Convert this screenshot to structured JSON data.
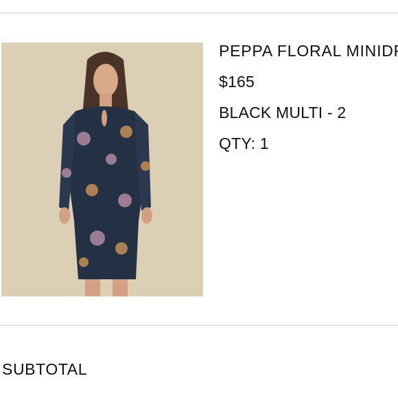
{
  "cart_item": {
    "name": "PEPPA FLORAL MINIDRESS",
    "price": "$165",
    "variant": "BLACK MULTI - 2",
    "quantity": "QTY: 1",
    "image_alt": "Model wearing a long-sleeve navy floral print minidress"
  },
  "summary": {
    "subtotal_label": "SUBTOTAL"
  },
  "colors": {
    "divider": "#e4e4e4",
    "image_background": "#dcd0b8",
    "dress": "#243044"
  }
}
